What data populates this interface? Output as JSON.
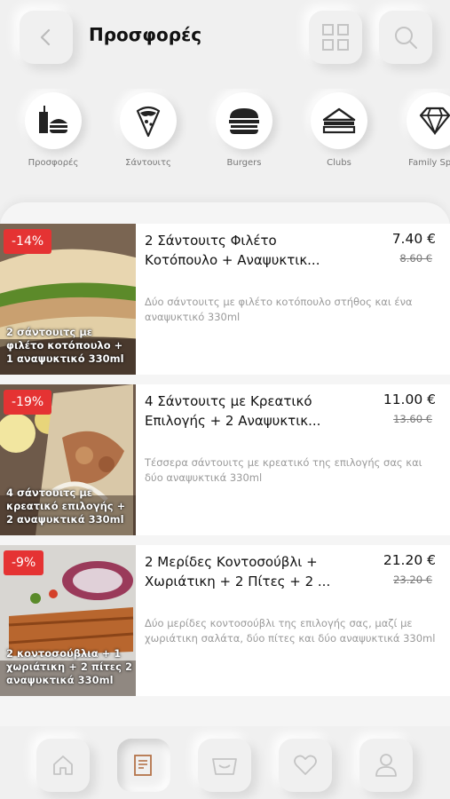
{
  "header": {
    "title": "Προσφορές",
    "icons": {
      "back": "back-arrow-icon",
      "grid": "grid-icon",
      "search": "search-icon"
    }
  },
  "categories": [
    {
      "label": "Προσφορές",
      "icon": "combo-meal-icon"
    },
    {
      "label": "Σάντουιτς",
      "icon": "wrap-sandwich-icon"
    },
    {
      "label": "Burgers",
      "icon": "burger-icon"
    },
    {
      "label": "Clubs",
      "icon": "club-sandwich-icon"
    },
    {
      "label": "Family Spec",
      "icon": "diamond-icon"
    }
  ],
  "offers": [
    {
      "discount": "-14%",
      "image_caption": "2 σάντουιτς με φιλέτο κοτόπουλο + 1 αναψυκτικό 330ml",
      "title": "2 Σάντουιτς Φιλέτο Κοτόπουλο + Αναψυκτικ...",
      "price": "7.40 €",
      "old_price": "8.60 €",
      "description": "Δύο σάντουιτς με φιλέτο κοτόπουλο στήθος και ένα αναψυκτικό 330ml"
    },
    {
      "discount": "-19%",
      "image_caption": "4 σάντουιτς με κρεατικό επιλογής + 2 αναψυκτικά 330ml",
      "title": "4 Σάντουιτς με Κρεατικό Επιλογής + 2 Αναψυκτικ...",
      "price": "11.00 €",
      "old_price": "13.60 €",
      "description": "Τέσσερα σάντουιτς με κρεατικό της επιλογής σας και δύο αναψυκτικά 330ml"
    },
    {
      "discount": "-9%",
      "image_caption": "2 κοντοσούβλια + 1 χωριάτικη + 2 πίτες 2 αναψυκτικά 330ml",
      "title": "2 Μερίδες Κοντοσούβλι + Χωριάτικη + 2 Πίτες + 2 ...",
      "price": "21.20 €",
      "old_price": "23.20 €",
      "description": "Δύο μερίδες κοντοσούβλι της επιλογής σας, μαζί με χωριάτικη σαλάτα, δύο πίτες και δύο αναψυκτικά 330ml"
    }
  ],
  "bottom_nav": [
    {
      "icon": "home-icon",
      "active": false
    },
    {
      "icon": "menu-document-icon",
      "active": true
    },
    {
      "icon": "basket-icon",
      "active": false
    },
    {
      "icon": "heart-icon",
      "active": false
    },
    {
      "icon": "user-icon",
      "active": false
    }
  ],
  "colors": {
    "accent": "#e53333",
    "background": "#f0f0f0",
    "active_icon": "#b5734a"
  }
}
